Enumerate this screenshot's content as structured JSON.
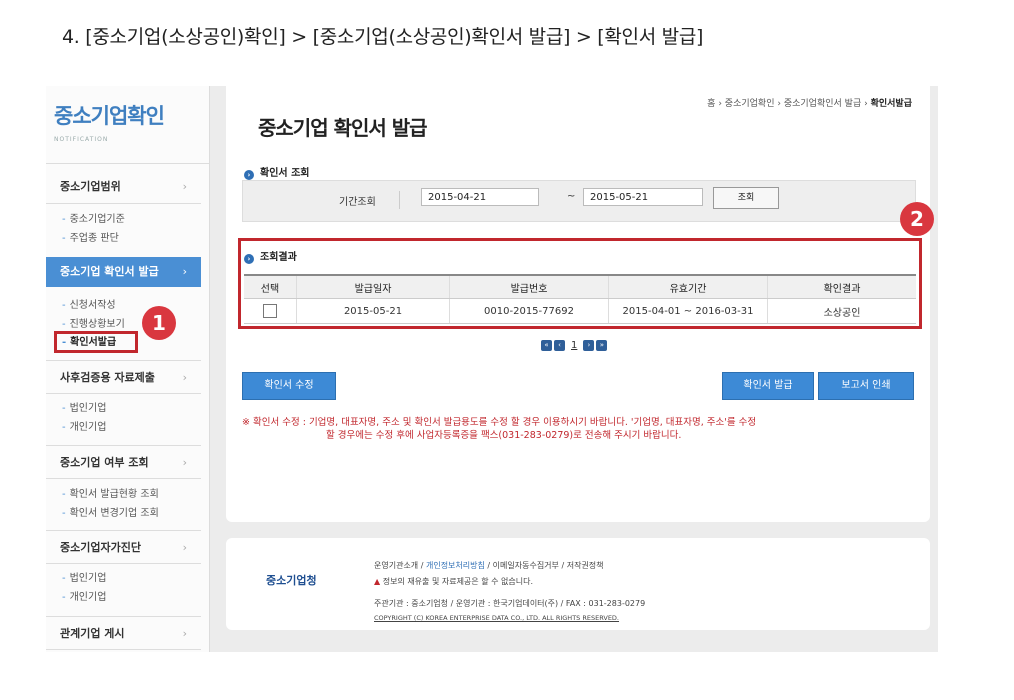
{
  "heading": "4. [중소기업(소상공인)확인] > [중소기업(소상공인)확인서 발급] > [확인서 발급]",
  "sidebar": {
    "logo": "중소기업확인",
    "logo_sub": "NOTIFICATION",
    "menus": [
      {
        "label": "중소기업범위",
        "subs": [
          "중소기업기준",
          "주업종 판단"
        ]
      },
      {
        "label": "중소기업 확인서 발급",
        "subs": [
          "신청서작성",
          "진행상황보기",
          "확인서발급"
        ]
      },
      {
        "label": "사후검증용 자료제출",
        "subs": [
          "법인기업",
          "개인기업"
        ]
      },
      {
        "label": "중소기업 여부 조회",
        "subs": [
          "확인서 발급현황 조회",
          "확인서 변경기업 조회"
        ]
      },
      {
        "label": "중소기업자가진단",
        "subs": [
          "법인기업",
          "개인기업"
        ]
      },
      {
        "label": "관계기업 게시",
        "subs": []
      }
    ],
    "arrow": "›"
  },
  "badges": {
    "one": "1",
    "two": "2"
  },
  "main": {
    "breadcrumb": [
      "홈",
      "중소기업확인",
      "중소기업확인서 발급",
      "확인서발급"
    ],
    "crumb_sep": "›",
    "title": "중소기업 확인서 발급",
    "search_section": "확인서 조회",
    "search": {
      "label": "기간조회",
      "from": "2015-04-21",
      "tilde": "~",
      "to": "2015-05-21",
      "button": "조회"
    },
    "result_section": "조회결과",
    "table": {
      "headers": [
        "선택",
        "발급일자",
        "발급번호",
        "유효기간",
        "확인결과"
      ],
      "rows": [
        [
          "",
          "2015-05-21",
          "0010-2015-77692",
          "2015-04-01 ~ 2016-03-31",
          "소상공인"
        ]
      ]
    },
    "pager": {
      "current": "1"
    },
    "buttons": {
      "edit": "확인서 수정",
      "issue": "확인서 발급",
      "print": "보고서 인쇄"
    },
    "note_line1": "※ 확인서 수정 : 기업명, 대표자명, 주소 및 확인서 발급용도를 수정 할 경우 이용하시기 바랍니다. '기업명, 대표자명, 주소'를 수정",
    "note_line2": "할 경우에는 수정 후에 사업자등록증을 팩스(031-283-0279)로 전송해 주시기 바랍니다."
  },
  "footer": {
    "logo": "중소기업청",
    "links": [
      "운영기관소개",
      "개인정보처리방침",
      "이메일자동수집거부",
      "저작권정책"
    ],
    "link_sep": "/",
    "warning": "정보의 재유출 및 자료제공은 할 수 없습니다.",
    "info": "주관기관 : 중소기업청 / 운영기관 : 한국기업데이터(주) / FAX : 031-283-0279",
    "copyright": "COPYRIGHT (C) KOREA ENTERPRISE DATA CO., LTD. ALL RIGHTS RESERVED."
  },
  "colors": {
    "accent": "#4a8fd4",
    "highlight": "#c1272d",
    "button": "#3d8ad6"
  }
}
